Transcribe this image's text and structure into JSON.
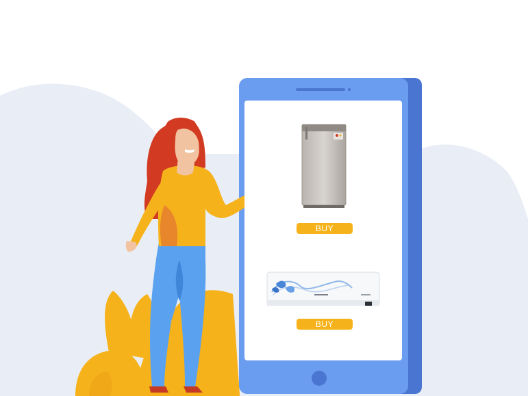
{
  "products": [
    {
      "name_icon": "refrigerator-icon",
      "buy_label": "BUY"
    },
    {
      "name_icon": "air-conditioner-icon",
      "buy_label": "BUY"
    }
  ],
  "colors": {
    "phone_body": "#6a9cf0",
    "phone_side": "#4a76d2",
    "buy_button": "#f5b21b",
    "backdrop": "#e9eef6",
    "plant": "#f5b21b",
    "hair": "#d23a22",
    "shirt": "#f5b21b",
    "pants": "#5aa2f0"
  }
}
